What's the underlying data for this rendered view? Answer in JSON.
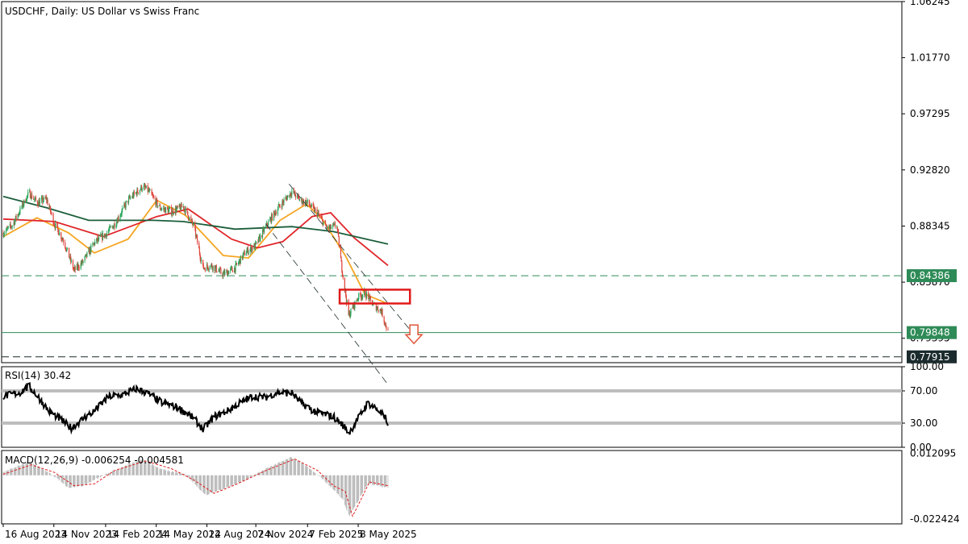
{
  "chart_data": [
    {
      "type": "candlestick",
      "title": "USDCHF, Daily:  US Dollar vs Swiss Franc",
      "ylim": [
        0.7745,
        1.0624
      ],
      "y_ticks": [
        "1.06245",
        "1.01770",
        "0.97295",
        "0.92820",
        "0.88345",
        "0.83870",
        "0.79395"
      ],
      "x_ticks": [
        "16 Aug 2023",
        "14 Nov 2023",
        "14 Feb 2024",
        "14 May 2024",
        "12 Aug 2024",
        "7 Nov 2024",
        "7 Feb 2025",
        "8 May 2025"
      ],
      "price_path": [
        [
          "2023-08-16",
          0.878
        ],
        [
          "2023-09-01",
          0.884
        ],
        [
          "2023-10-01",
          0.91
        ],
        [
          "2023-10-15",
          0.902
        ],
        [
          "2023-11-01",
          0.905
        ],
        [
          "2023-11-15",
          0.885
        ],
        [
          "2023-12-01",
          0.872
        ],
        [
          "2023-12-20",
          0.848
        ],
        [
          "2024-01-05",
          0.855
        ],
        [
          "2024-01-25",
          0.87
        ],
        [
          "2024-02-14",
          0.877
        ],
        [
          "2024-03-01",
          0.885
        ],
        [
          "2024-03-25",
          0.904
        ],
        [
          "2024-04-20",
          0.915
        ],
        [
          "2024-05-01",
          0.911
        ],
        [
          "2024-05-20",
          0.898
        ],
        [
          "2024-06-10",
          0.895
        ],
        [
          "2024-07-01",
          0.899
        ],
        [
          "2024-07-20",
          0.883
        ],
        [
          "2024-08-05",
          0.85
        ],
        [
          "2024-08-20",
          0.852
        ],
        [
          "2024-09-10",
          0.845
        ],
        [
          "2024-10-01",
          0.85
        ],
        [
          "2024-10-20",
          0.863
        ],
        [
          "2024-11-07",
          0.868
        ],
        [
          "2024-11-25",
          0.883
        ],
        [
          "2024-12-15",
          0.897
        ],
        [
          "2025-01-10",
          0.911
        ],
        [
          "2025-01-25",
          0.904
        ],
        [
          "2025-02-07",
          0.902
        ],
        [
          "2025-02-25",
          0.893
        ],
        [
          "2025-03-15",
          0.881
        ],
        [
          "2025-03-31",
          0.884
        ],
        [
          "2025-04-08",
          0.853
        ],
        [
          "2025-04-21",
          0.812
        ],
        [
          "2025-05-08",
          0.827
        ],
        [
          "2025-05-20",
          0.83
        ],
        [
          "2025-06-05",
          0.82
        ],
        [
          "2025-06-18",
          0.816
        ],
        [
          "2025-06-30",
          0.7985
        ]
      ],
      "moving_averages": [
        {
          "color": "#f5a623",
          "path": [
            [
              "2023-08-16",
              0.875
            ],
            [
              "2023-10-15",
              0.89
            ],
            [
              "2023-12-10",
              0.878
            ],
            [
              "2024-01-25",
              0.862
            ],
            [
              "2024-03-25",
              0.873
            ],
            [
              "2024-05-15",
              0.904
            ],
            [
              "2024-07-05",
              0.892
            ],
            [
              "2024-09-10",
              0.86
            ],
            [
              "2024-10-25",
              0.858
            ],
            [
              "2024-12-20",
              0.888
            ],
            [
              "2025-02-05",
              0.901
            ],
            [
              "2025-03-05",
              0.889
            ],
            [
              "2025-04-15",
              0.86
            ],
            [
              "2025-05-20",
              0.829
            ],
            [
              "2025-06-30",
              0.8215
            ]
          ]
        },
        {
          "color": "#e0262a",
          "path": [
            [
              "2023-08-16",
              0.889
            ],
            [
              "2023-11-15",
              0.887
            ],
            [
              "2024-02-10",
              0.875
            ],
            [
              "2024-05-15",
              0.891
            ],
            [
              "2024-07-10",
              0.897
            ],
            [
              "2024-09-25",
              0.873
            ],
            [
              "2024-11-10",
              0.866
            ],
            [
              "2024-12-25",
              0.871
            ],
            [
              "2025-02-15",
              0.891
            ],
            [
              "2025-03-20",
              0.894
            ],
            [
              "2025-05-01",
              0.874
            ],
            [
              "2025-06-30",
              0.852
            ]
          ]
        },
        {
          "color": "#1b5e3b",
          "path": [
            [
              "2023-08-16",
              0.907
            ],
            [
              "2023-11-01",
              0.898
            ],
            [
              "2024-01-15",
              0.888
            ],
            [
              "2024-05-10",
              0.888
            ],
            [
              "2024-07-01",
              0.887
            ],
            [
              "2024-10-01",
              0.881
            ],
            [
              "2025-01-10",
              0.883
            ],
            [
              "2025-03-25",
              0.879
            ],
            [
              "2025-06-30",
              0.869
            ]
          ]
        }
      ],
      "channel_lines": [
        [
          [
            "2024-11-25",
            0.885
          ],
          [
            "2025-06-30",
            0.757
          ]
        ],
        [
          [
            "2025-01-05",
            0.917
          ],
          [
            "2025-08-15",
            0.797
          ]
        ]
      ],
      "highlight_zone": {
        "from": "2025-04-05",
        "to": "2025-08-08",
        "high": 0.8327,
        "low": 0.8217
      },
      "horizontal_lines": [
        {
          "label": "0.84386",
          "value": 0.84386,
          "style": "dashed",
          "color": "#2e8b57",
          "tag_color": "#2e8b57"
        },
        {
          "label": "0.79848",
          "value": 0.79848,
          "style": "solid",
          "color": "#2e8b57",
          "tag_color": "#2e8b57"
        },
        {
          "label": "0.77915",
          "value": 0.77915,
          "style": "dashed",
          "color": "#1c2b2d",
          "tag_color": "#1c2b2d"
        }
      ],
      "arrow": {
        "direction": "down",
        "date": "2025-08-15",
        "value": 0.7975,
        "color": "#e0563a"
      }
    },
    {
      "type": "line",
      "label": "RSI(14) 30.42",
      "ylim": [
        0,
        100
      ],
      "y_ticks": [
        "100.00",
        "70.00",
        "30.00",
        "0.00"
      ],
      "levels": [
        70,
        30
      ],
      "path": [
        [
          "2023-08-16",
          63
        ],
        [
          "2023-09-15",
          68
        ],
        [
          "2023-10-01",
          76
        ],
        [
          "2023-10-20",
          60
        ],
        [
          "2023-11-05",
          45
        ],
        [
          "2023-11-25",
          35
        ],
        [
          "2023-12-15",
          24
        ],
        [
          "2024-01-10",
          38
        ],
        [
          "2024-01-25",
          45
        ],
        [
          "2024-02-20",
          63
        ],
        [
          "2024-03-15",
          65
        ],
        [
          "2024-04-10",
          73
        ],
        [
          "2024-05-01",
          66
        ],
        [
          "2024-05-25",
          55
        ],
        [
          "2024-06-20",
          50
        ],
        [
          "2024-07-20",
          36
        ],
        [
          "2024-08-05",
          22
        ],
        [
          "2024-08-25",
          38
        ],
        [
          "2024-09-15",
          44
        ],
        [
          "2024-10-10",
          55
        ],
        [
          "2024-11-01",
          63
        ],
        [
          "2024-11-25",
          62
        ],
        [
          "2024-12-15",
          68
        ],
        [
          "2025-01-10",
          67
        ],
        [
          "2025-01-25",
          56
        ],
        [
          "2025-02-20",
          44
        ],
        [
          "2025-03-25",
          38
        ],
        [
          "2025-04-10",
          28
        ],
        [
          "2025-04-22",
          18
        ],
        [
          "2025-05-08",
          36
        ],
        [
          "2025-05-25",
          55
        ],
        [
          "2025-06-15",
          45
        ],
        [
          "2025-06-30",
          30.42
        ]
      ]
    },
    {
      "type": "histogram",
      "label": "MACD(12,26,9) -0.006254 -0.004581",
      "ylim": [
        -0.025,
        0.0135
      ],
      "y_ticks": [
        "0.012095",
        "-0.022424"
      ],
      "histogram": [
        [
          "2023-08-16",
          0.002
        ],
        [
          "2023-10-01",
          0.008
        ],
        [
          "2023-11-15",
          0.0
        ],
        [
          "2023-12-10",
          -0.006
        ],
        [
          "2024-01-05",
          -0.005
        ],
        [
          "2024-02-14",
          0.001
        ],
        [
          "2024-03-25",
          0.006
        ],
        [
          "2024-04-20",
          0.009
        ],
        [
          "2024-05-20",
          0.004
        ],
        [
          "2024-07-05",
          0.001
        ],
        [
          "2024-08-10",
          -0.01
        ],
        [
          "2024-09-15",
          -0.006
        ],
        [
          "2024-10-20",
          -0.002
        ],
        [
          "2024-11-25",
          0.004
        ],
        [
          "2025-01-10",
          0.01
        ],
        [
          "2025-02-07",
          0.005
        ],
        [
          "2025-03-15",
          -0.004
        ],
        [
          "2025-04-10",
          -0.012
        ],
        [
          "2025-04-22",
          -0.021
        ],
        [
          "2025-05-10",
          -0.012
        ],
        [
          "2025-05-25",
          -0.004
        ],
        [
          "2025-06-30",
          -0.006
        ]
      ],
      "signal": [
        [
          "2023-08-16",
          0.001
        ],
        [
          "2023-10-05",
          0.006
        ],
        [
          "2023-11-15",
          0.002
        ],
        [
          "2023-12-20",
          -0.005
        ],
        [
          "2024-01-25",
          -0.004
        ],
        [
          "2024-03-01",
          0.003
        ],
        [
          "2024-04-25",
          0.008
        ],
        [
          "2024-06-10",
          0.004
        ],
        [
          "2024-07-20",
          -0.002
        ],
        [
          "2024-08-25",
          -0.009
        ],
        [
          "2024-10-05",
          -0.004
        ],
        [
          "2024-11-25",
          0.003
        ],
        [
          "2025-01-15",
          0.009
        ],
        [
          "2025-02-25",
          0.003
        ],
        [
          "2025-03-25",
          -0.005
        ],
        [
          "2025-04-15",
          -0.008
        ],
        [
          "2025-04-28",
          -0.021
        ],
        [
          "2025-05-15",
          -0.011
        ],
        [
          "2025-05-28",
          -0.003
        ],
        [
          "2025-06-30",
          -0.005
        ]
      ]
    }
  ]
}
